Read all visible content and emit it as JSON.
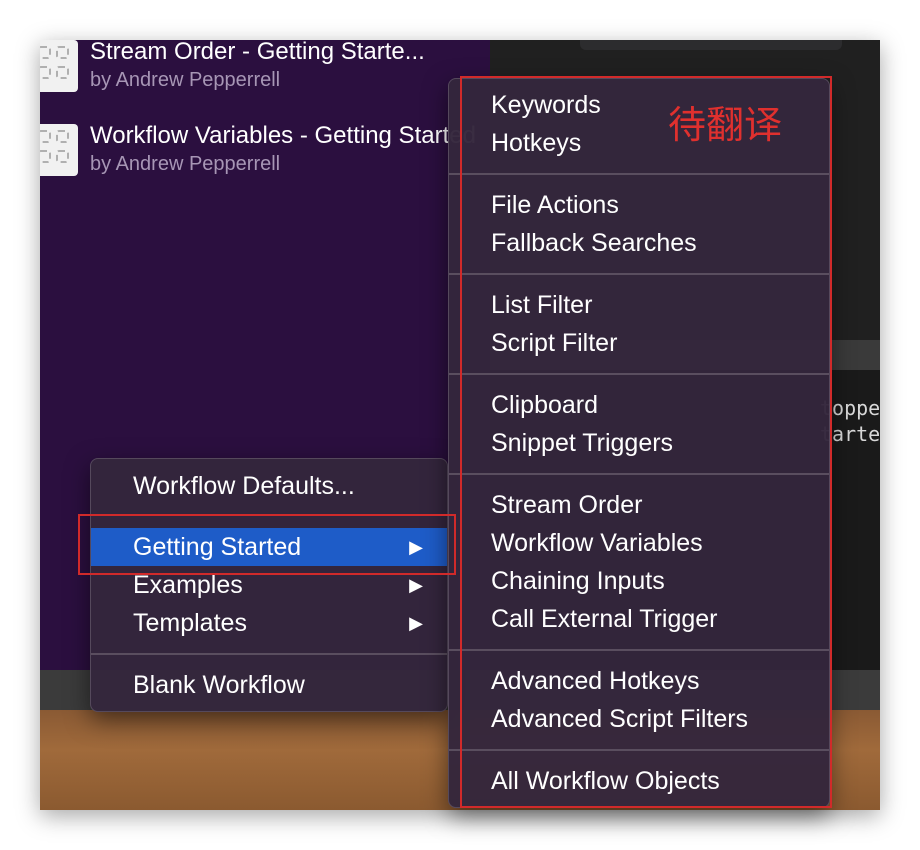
{
  "workflows": [
    {
      "title": "Stream Order - Getting Starte...",
      "author": "by Andrew Pepperrell"
    },
    {
      "title": "Workflow Variables - Getting Started",
      "author": "by Andrew Pepperrell"
    }
  ],
  "code_lines": [
    "toppe",
    "tarte"
  ],
  "menu": {
    "items": [
      {
        "label": "Workflow Defaults..."
      },
      {
        "label": "Getting Started",
        "arrow": "▶"
      },
      {
        "label": "Examples",
        "arrow": "▶"
      },
      {
        "label": "Templates",
        "arrow": "▶"
      },
      {
        "label": "Blank Workflow"
      }
    ]
  },
  "submenu": {
    "groups": [
      [
        "Keywords",
        "Hotkeys"
      ],
      [
        "File Actions",
        "Fallback Searches"
      ],
      [
        "List Filter",
        "Script Filter"
      ],
      [
        "Clipboard",
        "Snippet Triggers"
      ],
      [
        "Stream Order",
        "Workflow Variables",
        "Chaining Inputs",
        "Call External Trigger"
      ],
      [
        "Advanced Hotkeys",
        "Advanced Script Filters"
      ],
      [
        "All Workflow Objects"
      ]
    ]
  },
  "annotation": {
    "text": "待翻译",
    "color": "#e0302e"
  },
  "colors": {
    "highlight": "#1e5cc8",
    "purple_pane": "#2b0f3f",
    "annotation_box": "#d12a2a"
  }
}
